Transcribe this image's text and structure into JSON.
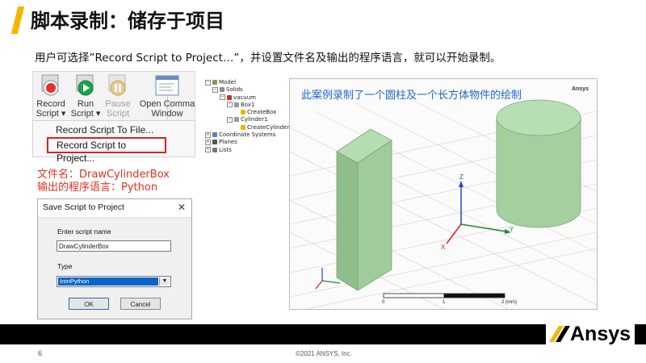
{
  "header": {
    "title": "脚本录制：储存于项目"
  },
  "intro": {
    "text": "用户可选择”Record Script to Project…”，并设置文件名及输出的程序语言，就可以开始录制。"
  },
  "ribbon": {
    "record_line1": "Record",
    "record_line2": "Script ▾",
    "run_line1": "Run",
    "run_line2": "Script ▾",
    "pause_line1": "Pause",
    "pause_line2": "Script",
    "open_line1": "Open Comma",
    "open_line2": "Window"
  },
  "menu": {
    "item_file": "Record Script To File...",
    "item_project": "Record Script to Project..."
  },
  "notes": {
    "filename": "文件名：DrawCylinderBox",
    "language": "输出的程序语言：Python"
  },
  "dialog": {
    "title": "Save Script to Project",
    "close": "✕",
    "name_label": "Enter script name",
    "name_value": "DrawCylinderBox",
    "type_label": "Type",
    "type_value": "IronPython",
    "ok": "OK",
    "cancel": "Cancel"
  },
  "tree": {
    "model": "Model",
    "solids": "Solids",
    "vacuum": "vacuum",
    "box1": "Box1",
    "create_box": "CreateBox",
    "cylinder1": "Cylinder1",
    "create_cylinder": "CreateCylinder",
    "coordinate_systems": "Coordinate Systems",
    "planes": "Planes",
    "lists": "Lists"
  },
  "viewport": {
    "caption": "此案例录制了一个圆柱及一个长方体物件的绘制",
    "brand": "Ansys",
    "axis_z": "Z",
    "axis_y": "Y",
    "axis_x": "X",
    "scale_0": "0",
    "scale_1": "1",
    "scale_2": "2 (mm)"
  },
  "footer": {
    "brand": "Ansys",
    "page": "6",
    "copyright": "©2021 ANSYS, Inc."
  },
  "colors": {
    "accent": "#f7b500",
    "highlight_red": "#e0201b",
    "shape_green": "#9fcc9a",
    "caption_blue": "#1f66d1"
  }
}
